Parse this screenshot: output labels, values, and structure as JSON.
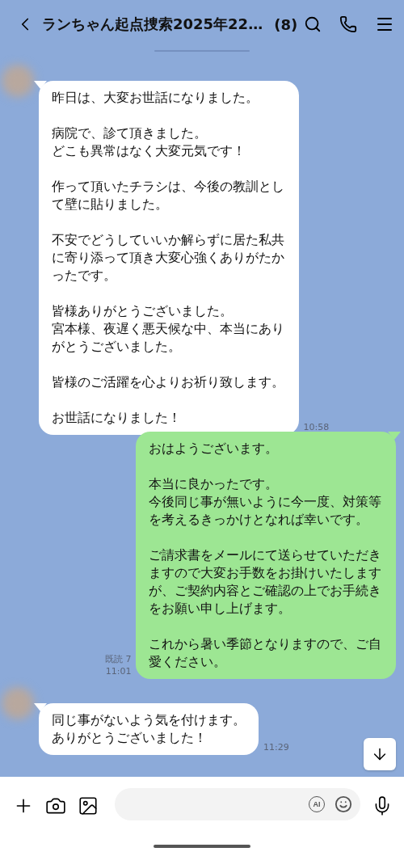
{
  "header": {
    "title": "ランちゃん起点捜索2025年22…",
    "member_count": "(8)"
  },
  "messages": [
    {
      "kind": "incoming",
      "paragraphs": [
        "昨日は、大変お世話になりました。",
        [
          "病院で、診て頂きました。",
          "どこも異常はなく大変元気です！"
        ],
        "作って頂いたチラシは、今後の教訓として壁に貼りました。",
        "不安でどうしていいか解らずに居た私共に寄り添って頂き大変心強くありがたかったです。",
        [
          "皆様ありがとうございました。",
          "宮本様、夜遅く悪天候な中、本当にありがとうございました。"
        ],
        "皆様のご活躍を心よりお祈り致します。",
        "お世話になりました！"
      ],
      "time": "10:58"
    },
    {
      "kind": "outgoing",
      "paragraphs": [
        "おはようございます。",
        [
          "本当に良かったです。",
          "今後同じ事が無いように今一度、対策等を考えるきっかけとなれば幸いです。"
        ],
        "ご請求書をメールにて送らせていただきますので大変お手数をお掛けいたしますが、ご契約内容とご確認の上でお手続きをお願い申し上げます。",
        "これから暑い季節となりますので、ご自愛ください。"
      ],
      "read": "既読 7",
      "time": "11:01"
    },
    {
      "kind": "incoming",
      "paragraphs": [
        [
          "同じ事がないよう気を付けます。",
          "ありがとうございました！"
        ]
      ],
      "time": "11:29"
    }
  ],
  "composer": {
    "ai_label": "AI"
  }
}
